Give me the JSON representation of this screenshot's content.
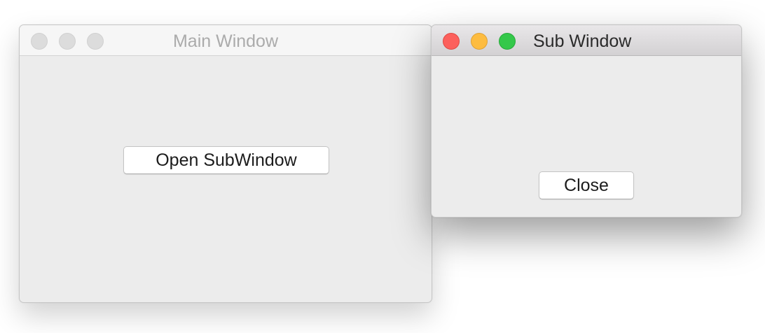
{
  "main_window": {
    "title": "Main Window",
    "open_button_label": "Open SubWindow"
  },
  "sub_window": {
    "title": "Sub Window",
    "close_button_label": "Close"
  },
  "colors": {
    "traffic_close": "#fc605c",
    "traffic_minimize": "#fdbc40",
    "traffic_maximize": "#34c84a",
    "traffic_inactive": "#dcdcdc",
    "window_background": "#ececec"
  }
}
